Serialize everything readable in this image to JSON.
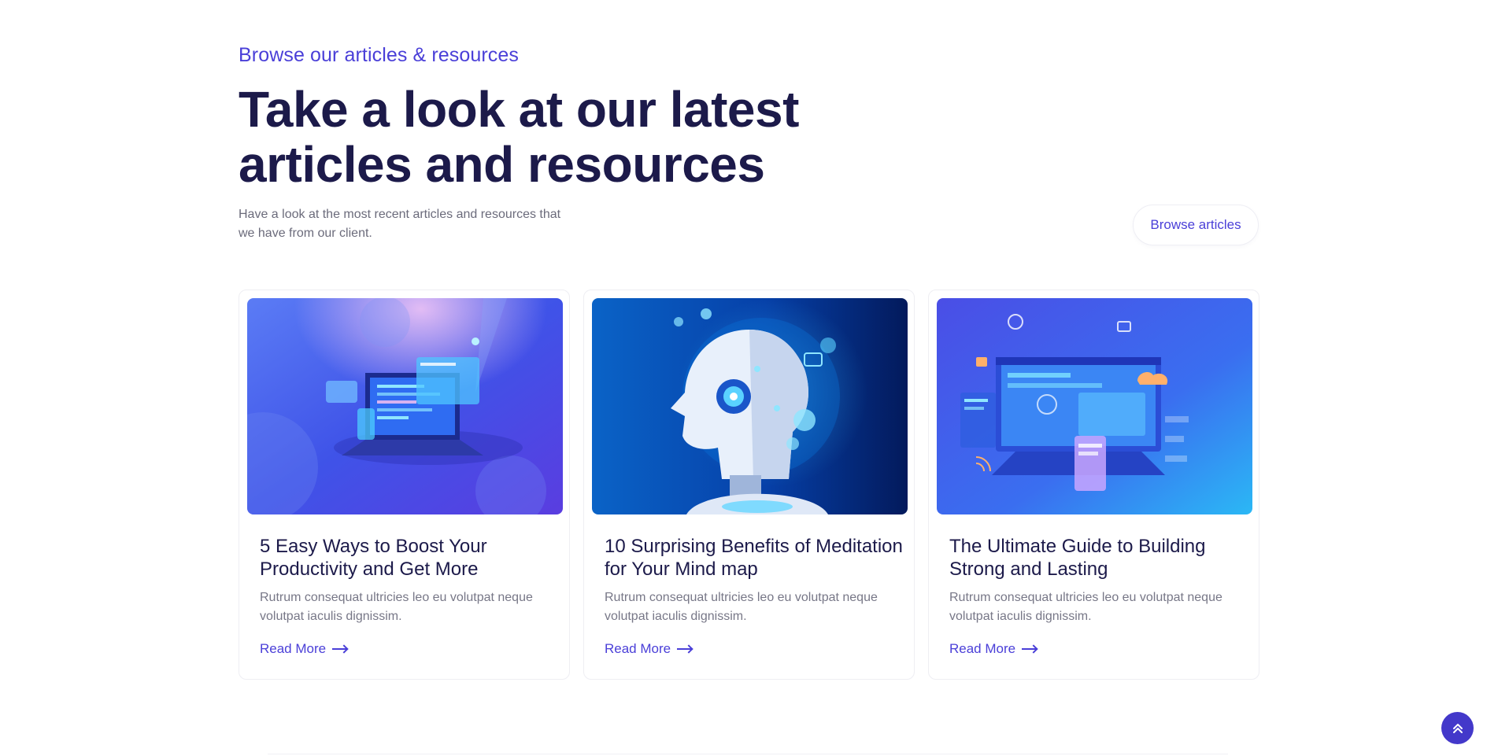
{
  "section": {
    "eyebrow": "Browse our articles & resources",
    "headline": "Take a look at our latest articles and resources",
    "intro": "Have a look at the most recent articles and resources that we have from our client.",
    "browse_button": "Browse articles"
  },
  "articles": [
    {
      "title": "5 Easy Ways to Boost Your Productivity and Get More",
      "excerpt": "Rutrum consequat ultricies leo eu volutpat neque volutpat iaculis dignissim.",
      "read_more": "Read More",
      "image_icon": "laptop-code-illustration"
    },
    {
      "title": "10 Surprising Benefits of Meditation for Your Mind map",
      "excerpt": "Rutrum consequat ultricies leo eu volutpat neque volutpat iaculis dignissim.",
      "read_more": "Read More",
      "image_icon": "ai-robot-head-illustration"
    },
    {
      "title": "The Ultimate Guide to Building Strong and Lasting",
      "excerpt": "Rutrum consequat ultricies leo eu volutpat neque volutpat iaculis dignissim.",
      "read_more": "Read More",
      "image_icon": "web-development-illustration"
    }
  ],
  "scroll_top_icon": "double-chevron-up-icon",
  "colors": {
    "accent": "#4a3fd8",
    "heading": "#1c1a4a",
    "body_text": "#777787",
    "scroll_button": "#4338ca"
  }
}
